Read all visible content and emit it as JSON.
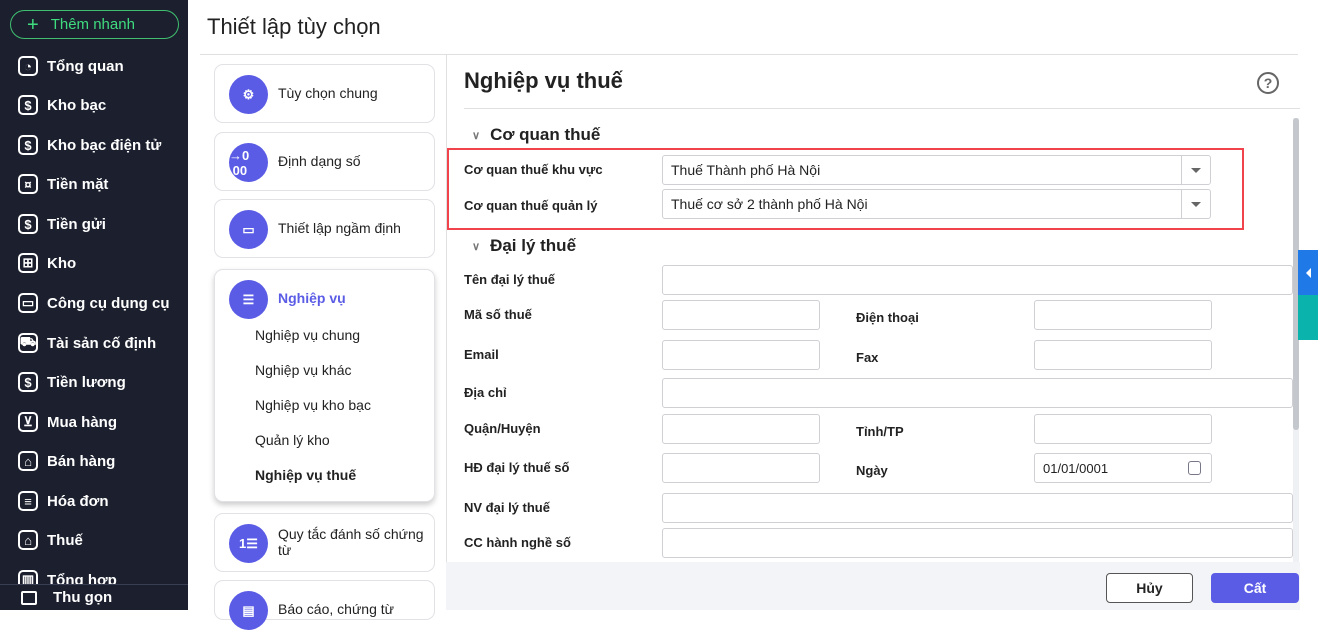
{
  "sidebar": {
    "quick_add": "Thêm nhanh",
    "items": [
      {
        "label": "Tổng quan",
        "icon": "pie-chart-icon"
      },
      {
        "label": "Kho bạc",
        "icon": "treasury-icon"
      },
      {
        "label": "Kho bạc điện tử",
        "icon": "e-treasury-icon"
      },
      {
        "label": "Tiền mặt",
        "icon": "cash-icon"
      },
      {
        "label": "Tiền gửi",
        "icon": "deposit-icon"
      },
      {
        "label": "Kho",
        "icon": "warehouse-icon"
      },
      {
        "label": "Công cụ dụng cụ",
        "icon": "tools-icon"
      },
      {
        "label": "Tài sản cố định",
        "icon": "truck-icon"
      },
      {
        "label": "Tiền lương",
        "icon": "salary-icon"
      },
      {
        "label": "Mua hàng",
        "icon": "cart-icon"
      },
      {
        "label": "Bán hàng",
        "icon": "store-icon"
      },
      {
        "label": "Hóa đơn",
        "icon": "invoice-icon"
      },
      {
        "label": "Thuế",
        "icon": "bank-icon"
      },
      {
        "label": "Tổng hợp",
        "icon": "book-icon"
      }
    ],
    "collapse": "Thu gọn"
  },
  "page_title": "Thiết lập tùy chọn",
  "nav": {
    "items": [
      {
        "label": "Tùy chọn chung",
        "glyph": "⚙"
      },
      {
        "label": "Định dạng số",
        "glyph": "→0 .00"
      },
      {
        "label": "Thiết lập ngầm định",
        "glyph": "▭"
      },
      {
        "label": "Nghiệp vụ",
        "glyph": "☰"
      },
      {
        "label": "Quy tắc đánh số chứng từ",
        "glyph": "1☰"
      },
      {
        "label": "Báo cáo, chứng từ",
        "glyph": "▤"
      }
    ],
    "sub_items": [
      "Nghiệp vụ chung",
      "Nghiệp vụ khác",
      "Nghiệp vụ kho bạc",
      "Quản lý kho",
      "Nghiệp vụ thuế"
    ]
  },
  "panel": {
    "title": "Nghiệp vụ thuế",
    "help": "?",
    "section1": {
      "title": "Cơ quan thuế",
      "regional_label": "Cơ quan thuế khu vực",
      "regional_value": "Thuế Thành phố Hà Nội",
      "managing_label": "Cơ quan thuế quản lý",
      "managing_value": "Thuế cơ sở 2 thành phố Hà Nội"
    },
    "section2": {
      "title": "Đại lý thuế",
      "name": "Tên đại lý thuế",
      "tax_code": "Mã số thuế",
      "phone": "Điện thoại",
      "email": "Email",
      "fax": "Fax",
      "address": "Địa chỉ",
      "district": "Quận/Huyện",
      "province": "Tỉnh/TP",
      "contract": "HĐ đại lý thuế số",
      "date": "Ngày",
      "date_value": "01/01/0001",
      "employee": "NV đại lý thuế",
      "cert": "CC hành nghề số"
    }
  },
  "footer": {
    "cancel": "Hủy",
    "save": "Cất"
  },
  "colors": {
    "accent": "#5b5ce6",
    "sidebar": "#1c1f2e",
    "highlight": "#f0434b"
  }
}
